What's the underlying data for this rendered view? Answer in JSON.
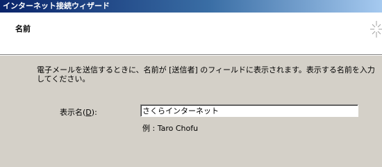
{
  "window": {
    "title": "インターネット接続ウィザード"
  },
  "header": {
    "title": "名前",
    "graphic_icon": "wizard-sparkle-icon"
  },
  "content": {
    "description": "電子メールを送信するときに、名前が [送信者] のフィールドに表示されます。表示する名前を入力してください。",
    "display_name_label_pre": "表示名(",
    "display_name_label_key": "D",
    "display_name_label_post": "):",
    "display_name_value": "さくらインターネット",
    "example": "例 : Taro Chofu"
  },
  "colors": {
    "titlebar_start": "#0a246a",
    "titlebar_end": "#a6caf0",
    "dialog_face": "#d4d0c8",
    "header_background": "#ffffff"
  }
}
